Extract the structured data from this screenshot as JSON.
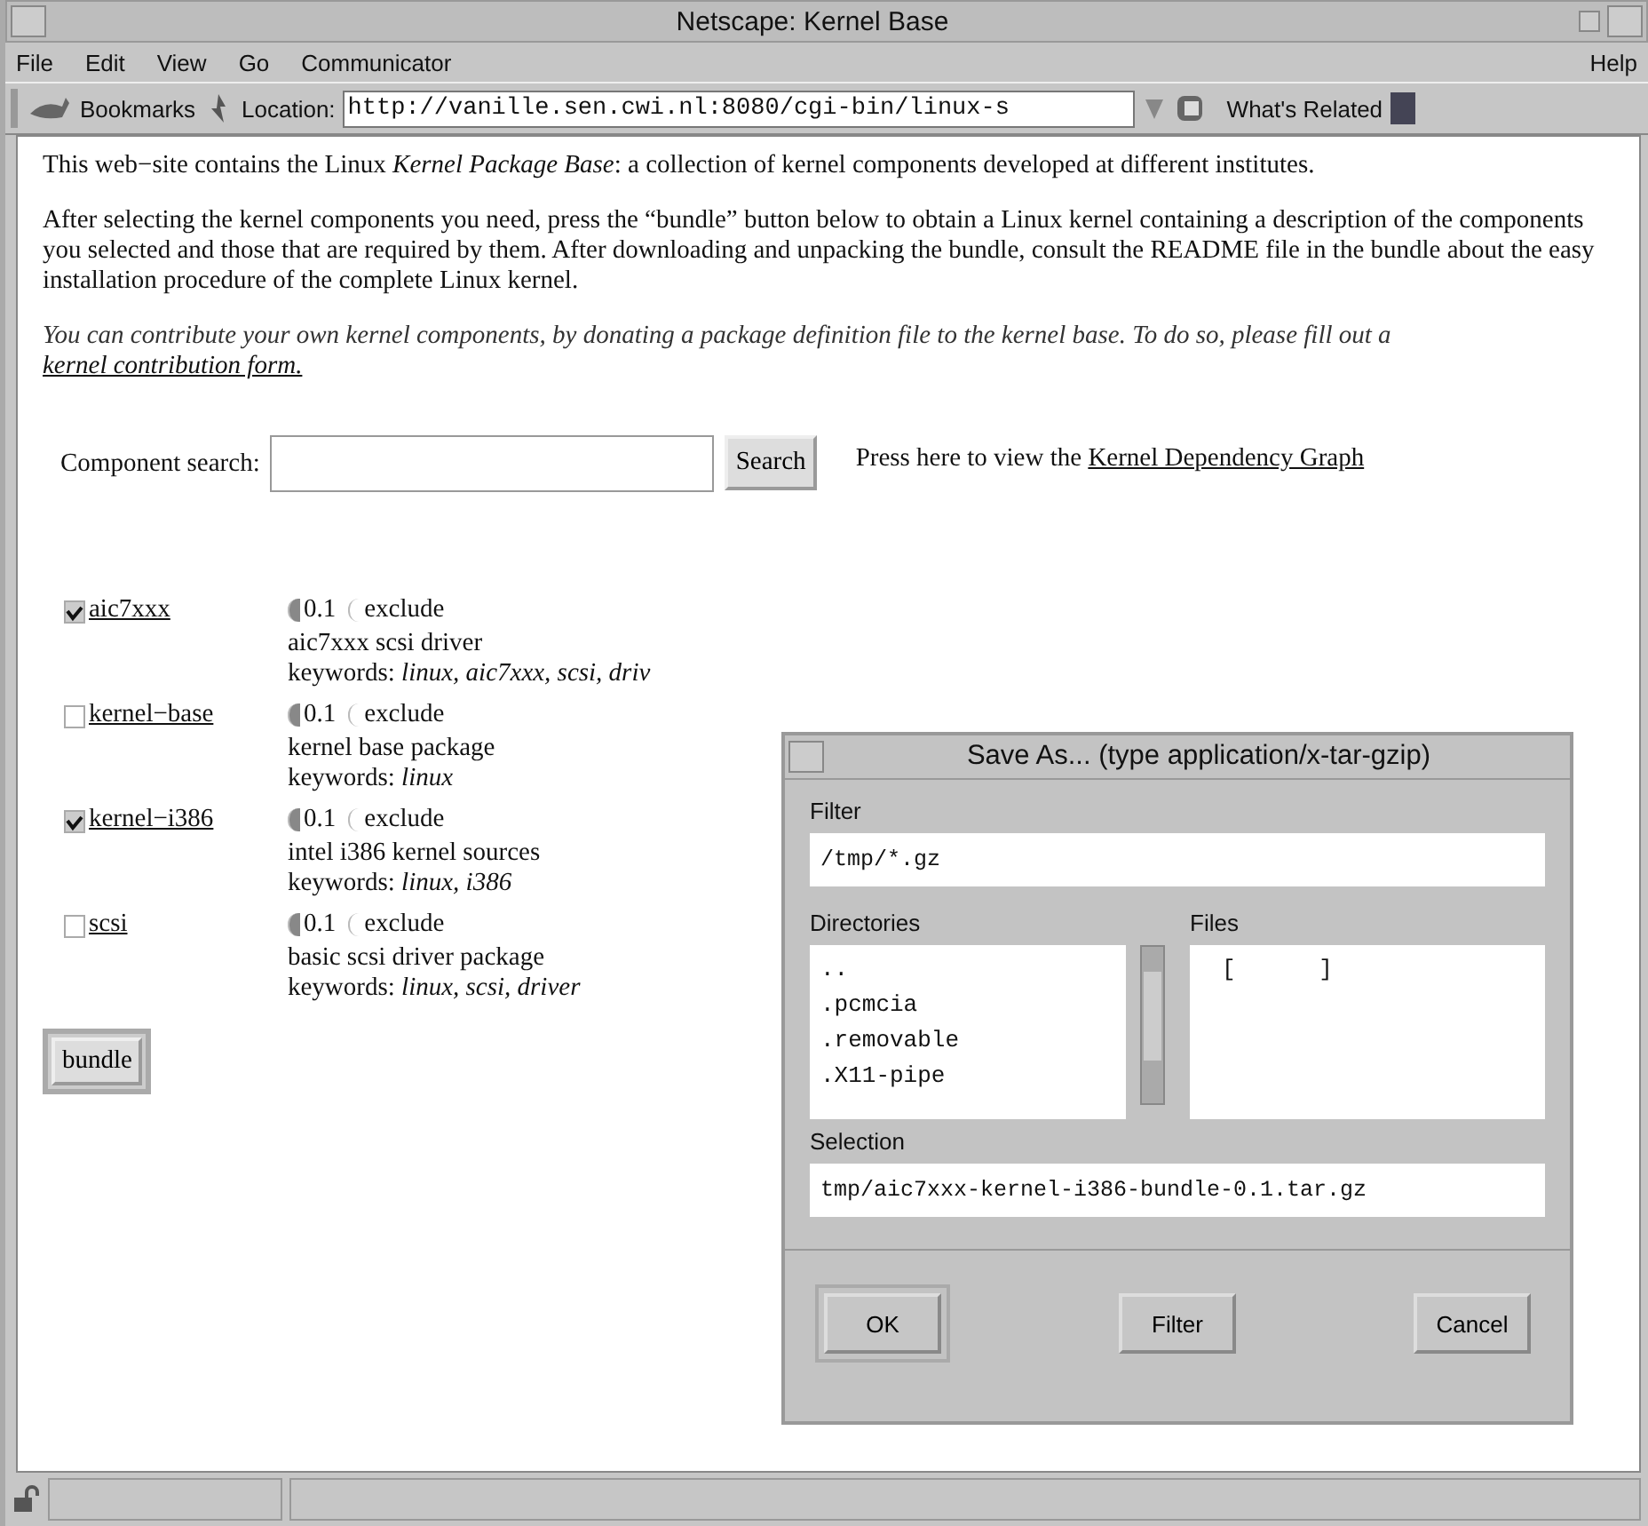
{
  "window": {
    "title": "Netscape: Kernel Base"
  },
  "menu": [
    "File",
    "Edit",
    "View",
    "Go",
    "Communicator"
  ],
  "help_menu": "Help",
  "toolbar": {
    "bookmarks": "Bookmarks",
    "location_label": "Location:",
    "location": "http://vanille.sen.cwi.nl:8080/cgi-bin/linux-s",
    "related": "What's Related"
  },
  "paragraphs": [
    {
      "kind": "plain",
      "text": "This web−site contains the Linux *Kernel Package Base*: a collection of kernel components developed at different institutes."
    },
    {
      "kind": "plain",
      "text": "After selecting the kernel components you need, press the “bundle” button below to obtain a Linux kernel containing a description of the components you selected and those that are required by them. After downloading and unpacking the bundle, consult the README file in the bundle about the easy installation procedure of the complete Linux kernel."
    },
    {
      "kind": "note",
      "text": "You can contribute your own kernel components, by donating a package definition file to the kernel base. To do so, please fill out a ",
      "link": "kernel contribution form."
    }
  ],
  "search": {
    "label": "Component search:",
    "button": "Search",
    "hint": "Press here to view the ",
    "link": "Kernel Dependency Graph"
  },
  "components": [
    {
      "name": "aic7xxx",
      "checked": true,
      "options": [
        {
          "label": "0.1",
          "selected": true
        },
        {
          "label": "exclude",
          "selected": false
        }
      ],
      "description": "aic7xxx scsi driver",
      "keywords": "keywords: *linux, aic7xxx, scsi, driv*"
    },
    {
      "name": "kernel−base",
      "checked": false,
      "options": [
        {
          "label": "0.1",
          "selected": true
        },
        {
          "label": "exclude",
          "selected": false
        }
      ],
      "description": "kernel base package",
      "keywords": "keywords: *linux*"
    },
    {
      "name": "kernel−i386",
      "checked": true,
      "options": [
        {
          "label": "0.1",
          "selected": true
        },
        {
          "label": "exclude",
          "selected": false
        }
      ],
      "description": "intel i386 kernel sources",
      "keywords": "keywords: *linux, i386*"
    },
    {
      "name": "scsi",
      "checked": false,
      "options": [
        {
          "label": "0.1",
          "selected": true
        },
        {
          "label": "exclude",
          "selected": false
        }
      ],
      "description": "basic scsi driver package",
      "keywords": "keywords: *linux, scsi, driver*"
    }
  ],
  "bundle_button": "bundle",
  "dialog": {
    "title": "Save As... (type application/x-tar-gzip)",
    "filter_label": "Filter",
    "filter": "/tmp/*.gz",
    "directories_label": "Directories",
    "directories": [
      "..",
      ".pcmcia",
      ".removable",
      ".X11-pipe"
    ],
    "files_label": "Files",
    "files": [
      "[      ]"
    ],
    "selection_label": "Selection",
    "selection": "tmp/aic7xxx-kernel-i386-bundle-0.1.tar.gz",
    "buttons": [
      "OK",
      "Filter",
      "Cancel"
    ]
  }
}
